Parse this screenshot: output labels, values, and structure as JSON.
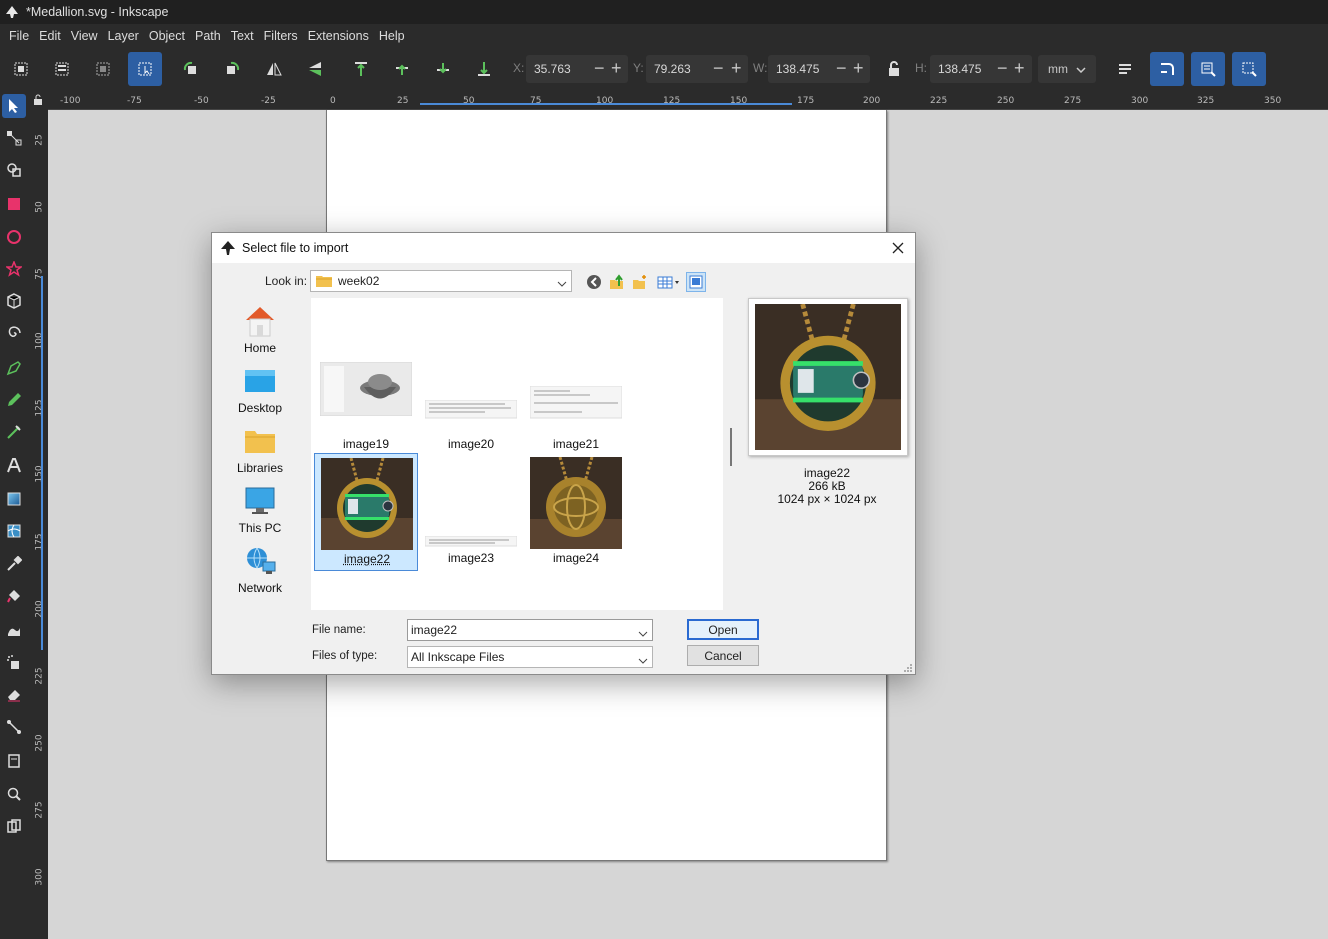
{
  "window": {
    "title": "*Medallion.svg - Inkscape"
  },
  "menu": [
    "File",
    "Edit",
    "View",
    "Layer",
    "Object",
    "Path",
    "Text",
    "Filters",
    "Extensions",
    "Help"
  ],
  "toolbar": {
    "x_label": "X:",
    "x_value": "35.763",
    "y_label": "Y:",
    "y_value": "79.263",
    "w_label": "W:",
    "w_value": "138.475",
    "h_label": "H:",
    "h_value": "138.475",
    "unit": "mm"
  },
  "ruler": {
    "h_labels": [
      "-100",
      "-75",
      "-50",
      "-25",
      "0",
      "25",
      "50",
      "75",
      "100",
      "125",
      "150",
      "175",
      "200",
      "225",
      "250",
      "275",
      "300",
      "325",
      "350"
    ],
    "v_labels": [
      "25",
      "50",
      "75",
      "100",
      "125",
      "150",
      "175",
      "200",
      "225",
      "250",
      "275",
      "300"
    ]
  },
  "dialog": {
    "title": "Select file to import",
    "look_in_label": "Look in:",
    "look_in_value": "week02",
    "places": [
      "Home",
      "Desktop",
      "Libraries",
      "This PC",
      "Network"
    ],
    "files": [
      {
        "name": "image19",
        "kind": "bowl"
      },
      {
        "name": "image20",
        "kind": "doc"
      },
      {
        "name": "image21",
        "kind": "doc"
      },
      {
        "name": "image22",
        "kind": "medallion-card",
        "selected": true
      },
      {
        "name": "image23",
        "kind": "doc"
      },
      {
        "name": "image24",
        "kind": "medallion-globe"
      }
    ],
    "preview": {
      "name": "image22",
      "size": "266 kB",
      "dimensions": "1024 px × 1024 px"
    },
    "file_name_label": "File name:",
    "file_name_value": "image22",
    "file_type_label": "Files of type:",
    "file_type_value": "All Inkscape Files",
    "open_label": "Open",
    "cancel_label": "Cancel"
  },
  "colors": {
    "accent": "#2d5fa3",
    "chrome": "#2b2b2b",
    "selection": "#cce8ff"
  }
}
